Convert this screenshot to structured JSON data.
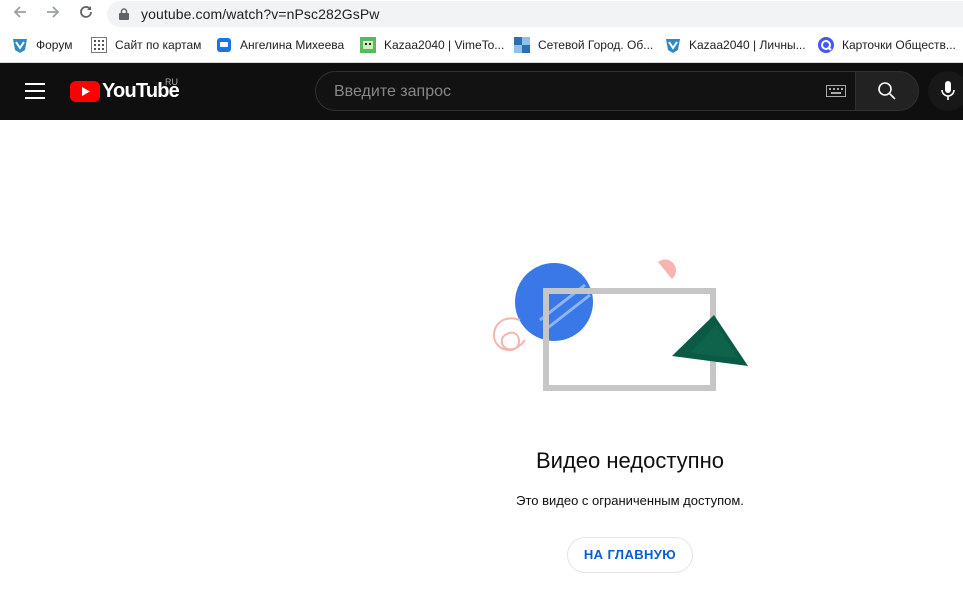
{
  "browser": {
    "url": "youtube.com/watch?v=nPsc282GsPw",
    "bookmarks": [
      {
        "label": "Форум",
        "icon": "vk-shield-icon"
      },
      {
        "label": "Сайт по картам",
        "icon": "grid-icon"
      },
      {
        "label": "Ангелина Михеева",
        "icon": "chat-icon"
      },
      {
        "label": "Kazaa2040 | VimeTo...",
        "icon": "vime-icon"
      },
      {
        "label": "Сетевой Город. Об...",
        "icon": "network-city-icon"
      },
      {
        "label": "Kazaa2040 | Личны...",
        "icon": "vk-shield-icon"
      },
      {
        "label": "Карточки Обществ...",
        "icon": "quizlet-icon"
      }
    ]
  },
  "youtube": {
    "logo_text": "YouTube",
    "country_code": "RU",
    "search_placeholder": "Введите запрос"
  },
  "main": {
    "title": "Видео недоступно",
    "subtitle": "Это видео с ограниченным доступом.",
    "home_button": "НА ГЛАВНУЮ"
  },
  "colors": {
    "header_bg": "#0f0f0f",
    "brand_red": "#ff0000",
    "link_blue": "#065fd4"
  }
}
